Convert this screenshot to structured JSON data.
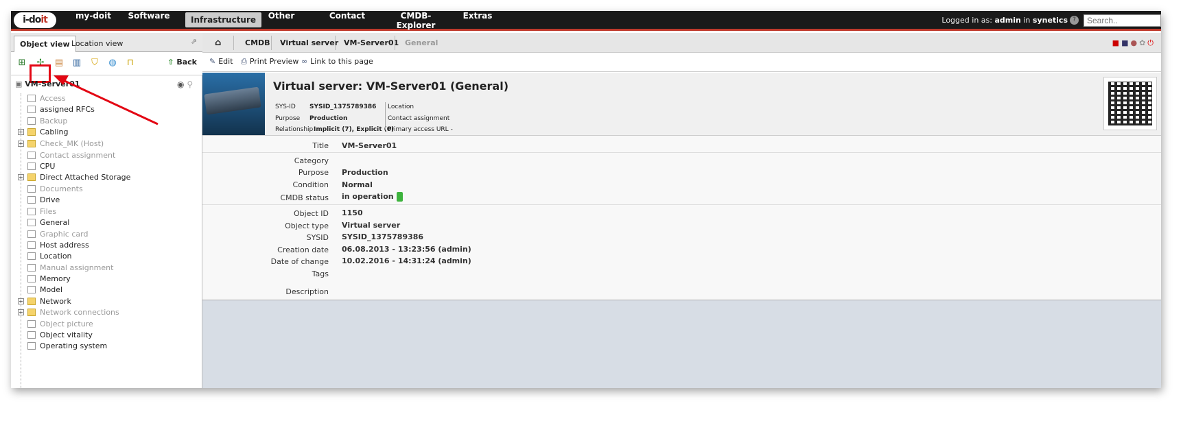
{
  "logo": {
    "text_a": "i-do",
    "text_b": "it"
  },
  "nav": [
    "my-doit",
    "Software",
    "Infrastructure",
    "Other",
    "Contact",
    "CMDB-Explorer",
    "Extras"
  ],
  "login": {
    "prefix": "Logged in as:",
    "user": "admin",
    "in": "in",
    "tenant": "synetics"
  },
  "search": {
    "placeholder": "Search.."
  },
  "tabs": {
    "object_view": "Object view",
    "location_view": "Location view"
  },
  "back_label": "Back",
  "tree": {
    "root": "VM-Server01",
    "items": [
      {
        "label": "Access",
        "dim": true,
        "folder": false
      },
      {
        "label": "assigned RFCs",
        "dim": false,
        "folder": false
      },
      {
        "label": "Backup",
        "dim": true,
        "folder": false
      },
      {
        "label": "Cabling",
        "dim": false,
        "folder": true
      },
      {
        "label": "Check_MK (Host)",
        "dim": true,
        "folder": true
      },
      {
        "label": "Contact assignment",
        "dim": true,
        "folder": false
      },
      {
        "label": "CPU",
        "dim": false,
        "folder": false
      },
      {
        "label": "Direct Attached Storage",
        "dim": false,
        "folder": true
      },
      {
        "label": "Documents",
        "dim": true,
        "folder": false
      },
      {
        "label": "Drive",
        "dim": false,
        "folder": false
      },
      {
        "label": "Files",
        "dim": true,
        "folder": false
      },
      {
        "label": "General",
        "dim": false,
        "folder": false
      },
      {
        "label": "Graphic card",
        "dim": true,
        "folder": false
      },
      {
        "label": "Host address",
        "dim": false,
        "folder": false
      },
      {
        "label": "Location",
        "dim": false,
        "folder": false
      },
      {
        "label": "Manual assignment",
        "dim": true,
        "folder": false
      },
      {
        "label": "Memory",
        "dim": false,
        "folder": false
      },
      {
        "label": "Model",
        "dim": false,
        "folder": false
      },
      {
        "label": "Network",
        "dim": false,
        "folder": true
      },
      {
        "label": "Network connections",
        "dim": true,
        "folder": true
      },
      {
        "label": "Object picture",
        "dim": true,
        "folder": false
      },
      {
        "label": "Object vitality",
        "dim": false,
        "folder": false
      },
      {
        "label": "Operating system",
        "dim": false,
        "folder": false
      }
    ]
  },
  "breadcrumb": [
    "CMDB",
    "Virtual server",
    "VM-Server01",
    "General"
  ],
  "toolbar": {
    "edit": "Edit",
    "print": "Print Preview",
    "link": "Link to this page"
  },
  "header": {
    "title": "Virtual server: VM-Server01 (General)",
    "sysid_label": "SYS-ID",
    "sysid_value": "SYSID_1375789386",
    "purpose_label": "Purpose",
    "purpose_value": "Production",
    "relationship_label": "Relationship",
    "relationship_value": "Implicit (7), Explicit (0)",
    "location_label": "Location",
    "contact_label": "Contact assignment",
    "primary_url_label": "Primary access URL",
    "primary_url_value": "-"
  },
  "fields": {
    "title_label": "Title",
    "title_value": "VM-Server01",
    "category_label": "Category",
    "purpose_label": "Purpose",
    "purpose_value": "Production",
    "condition_label": "Condition",
    "condition_value": "Normal",
    "cmdb_label": "CMDB status",
    "cmdb_value": "in operation",
    "objid_label": "Object ID",
    "objid_value": "1150",
    "objtype_label": "Object type",
    "objtype_value": "Virtual server",
    "sysid_label": "SYSID",
    "sysid_value": "SYSID_1375789386",
    "created_label": "Creation date",
    "created_value": "06.08.2013 - 13:23:56 (admin)",
    "changed_label": "Date of change",
    "changed_value": "10.02.2016 - 14:31:24 (admin)",
    "tags_label": "Tags",
    "desc_label": "Description"
  },
  "colors": {
    "accent": "#c0392b",
    "status_green": "#3db33d",
    "annotation": "#e30613"
  }
}
